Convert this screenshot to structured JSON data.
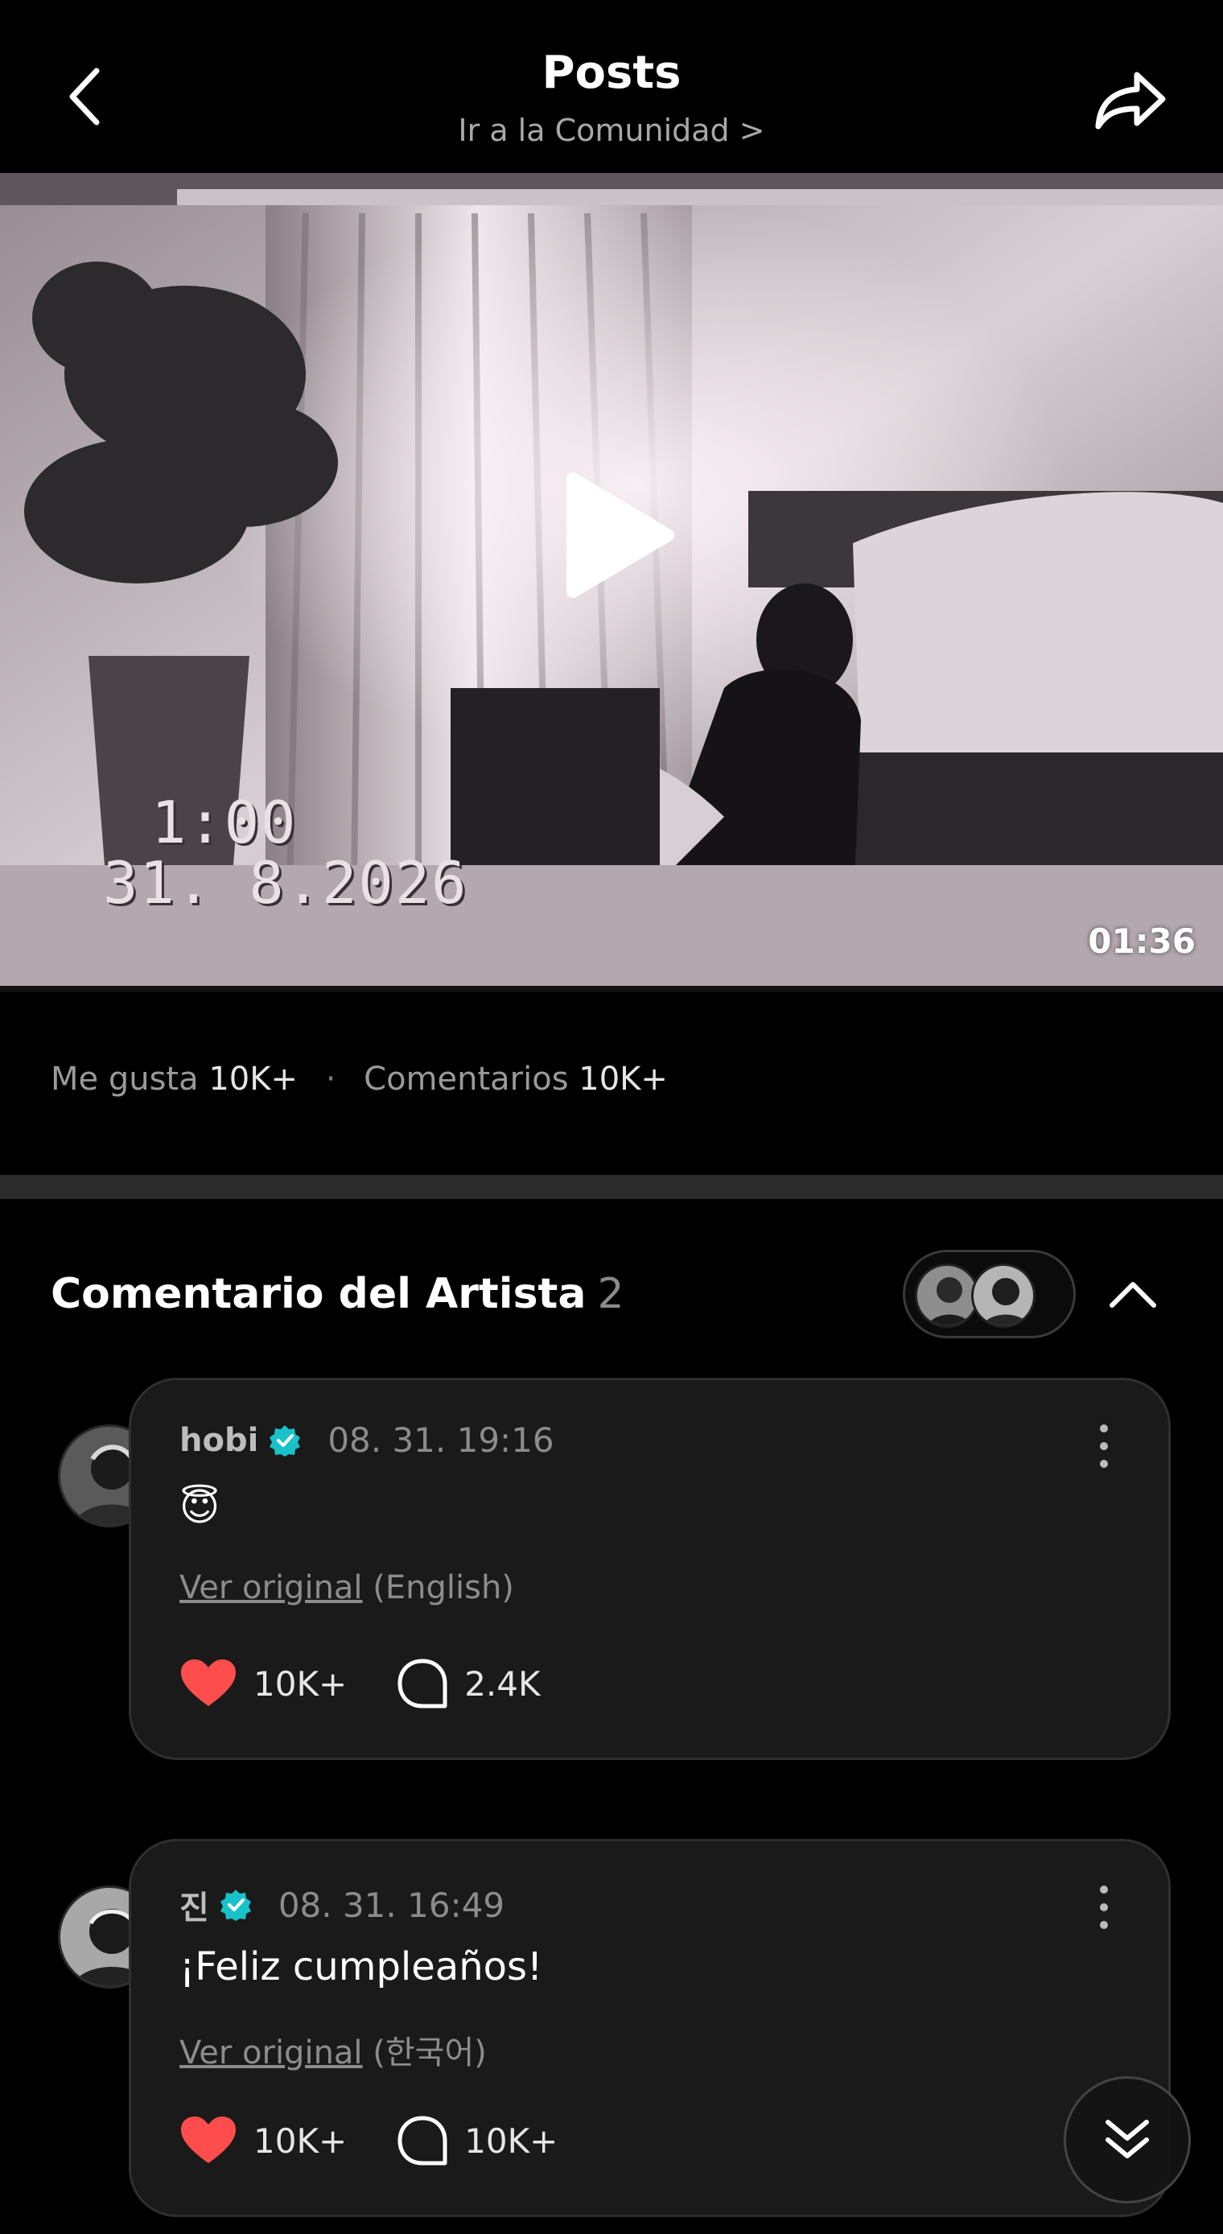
{
  "header": {
    "title": "Posts",
    "subtitle": "Ir a la Comunidad >"
  },
  "video": {
    "stamp_time": "1:00",
    "stamp_date": "31. 8.2026",
    "duration": "01:36"
  },
  "stats": {
    "likes_label": "Me gusta",
    "likes_value": "10K+",
    "separator": "·",
    "comments_label": "Comentarios",
    "comments_value": "10K+"
  },
  "artist_comments": {
    "title": "Comentario del Artista",
    "count": "2",
    "items": [
      {
        "name": "hobi",
        "date": "08. 31. 19:16",
        "body": "😇",
        "original_link": "Ver original",
        "original_lang": "(English)",
        "likes": "10K+",
        "replies": "2.4K"
      },
      {
        "name": "진",
        "date": "08. 31. 16:49",
        "body": "¡Feliz cumpleaños!",
        "original_link": "Ver original",
        "original_lang": "(한국어)",
        "likes": "10K+",
        "replies": "10K+"
      }
    ]
  },
  "colors": {
    "background": "#000000",
    "card": "#1a1a1a",
    "heart": "#ff4d4d",
    "verified": "#19c2c9",
    "muted_text": "#8c8c8c"
  },
  "icons": {
    "back": "chevron-left-icon",
    "share": "share-arrow-icon",
    "play": "play-icon",
    "collapse": "chevron-up-icon",
    "more": "kebab-icon",
    "like": "heart-icon",
    "reply": "speech-bubble-icon",
    "scroll": "double-chevron-down-icon"
  }
}
